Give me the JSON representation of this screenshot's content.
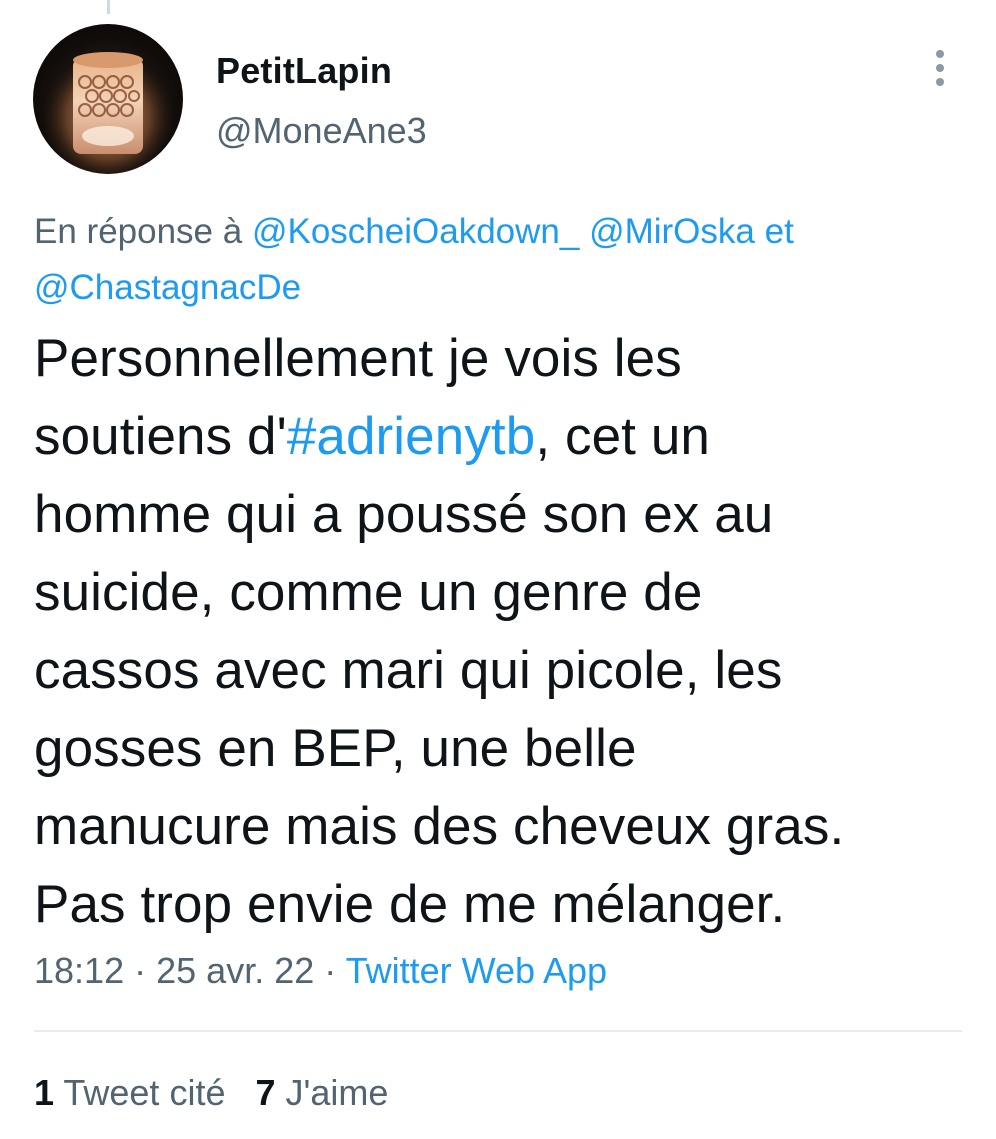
{
  "author": {
    "display_name": "PetitLapin",
    "handle": "@MoneAne3"
  },
  "reply_context": {
    "prefix": "En réponse à",
    "mention_1": "@KoscheiOakdown_",
    "mention_2": "@MirOska",
    "conjunction": "et",
    "mention_3": "@ChastagnacDe"
  },
  "tweet": {
    "line_1": "Personnellement je vois les",
    "line_2_before": "soutiens d'",
    "hashtag": "#adrienytb",
    "line_2_after": ", cet un",
    "line_3": "homme qui a poussé son ex au",
    "line_4": "suicide, comme un genre de",
    "line_5": "cassos avec mari qui picole, les",
    "line_6": "gosses en BEP, une belle",
    "line_7": "manucure mais des cheveux gras.",
    "line_8": "Pas trop envie de me mélanger."
  },
  "meta": {
    "time": "18:12",
    "separator": "·",
    "date": "25 avr. 22",
    "source": "Twitter Web App"
  },
  "stats": {
    "quotes_count": "1",
    "quotes_label": "Tweet cité",
    "likes_count": "7",
    "likes_label": "J'aime"
  },
  "icons": {
    "more": "more-vertical-icon",
    "avatar": "candle-avatar-image"
  },
  "colors": {
    "link": "#1d9bf0",
    "secondary_text": "#536471",
    "primary_text": "#0f1419",
    "divider": "#e7ecef"
  }
}
